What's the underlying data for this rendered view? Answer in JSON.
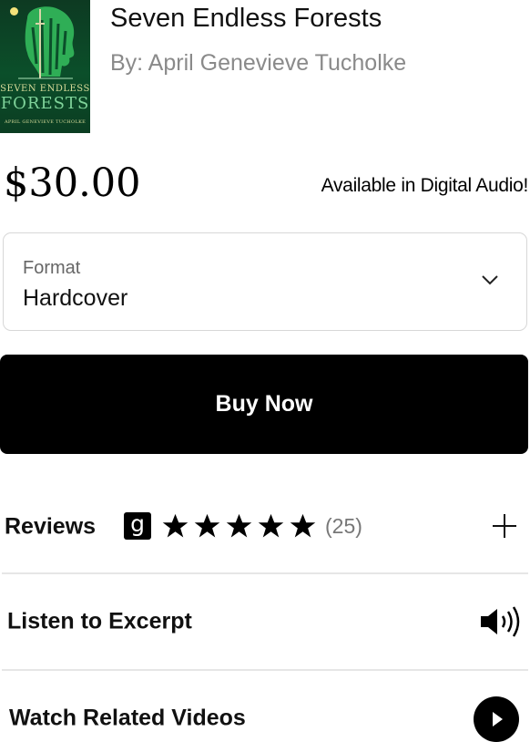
{
  "book": {
    "title": "Seven Endless Forests",
    "author_line": "By: April Genevieve Tucholke",
    "cover": {
      "title_line_1": "SEVEN ENDLESS",
      "title_line_2": "FORESTS",
      "author": "APRIL GENEVIEVE TUCHOLKE"
    }
  },
  "price": "$30.00",
  "availability": "Available in Digital Audio!",
  "format": {
    "label": "Format",
    "value": "Hardcover"
  },
  "buy_button": {
    "label": "Buy Now"
  },
  "reviews": {
    "label": "Reviews",
    "badge": "g",
    "rating": 5,
    "count": "(25)"
  },
  "excerpt": {
    "label": "Listen to Excerpt"
  },
  "videos": {
    "label": "Watch Related Videos"
  },
  "colors": {
    "cover_green": "#0b4f2a",
    "cover_accent": "#7fd39a",
    "muted_text": "#8a8a8a",
    "divider": "#e6e6e6",
    "button_bg": "#000000"
  },
  "icons": [
    "chevron-down-icon",
    "goodreads-icon",
    "star-icon",
    "plus-icon",
    "speaker-icon",
    "play-icon"
  ]
}
